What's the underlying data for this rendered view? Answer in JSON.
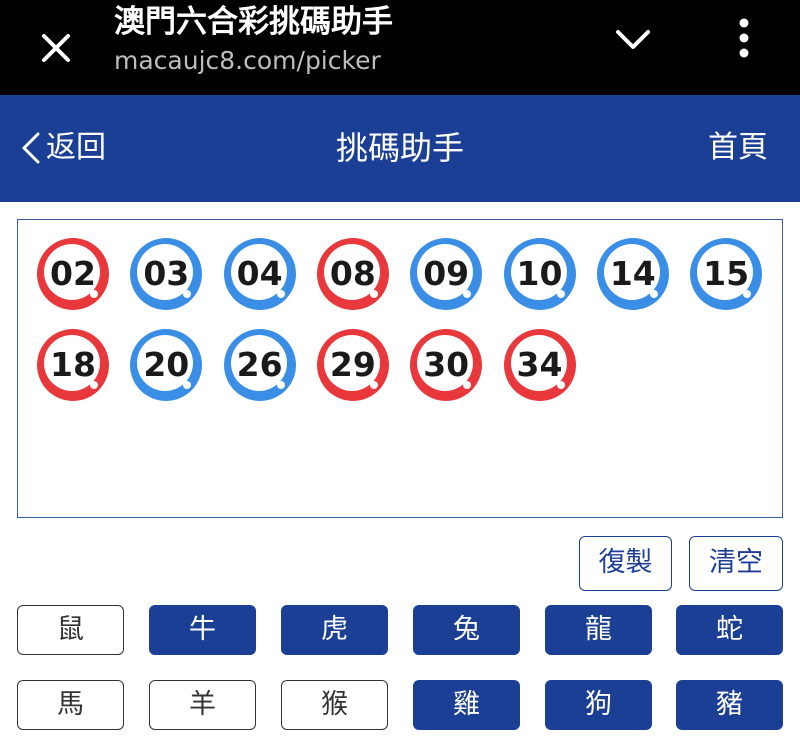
{
  "browser": {
    "title": "澳門六合彩挑碼助手",
    "url": "macaujc8.com/picker",
    "close_icon": "close-icon",
    "expand_icon": "chevron-down-icon",
    "menu_icon": "more-vertical-icon"
  },
  "header": {
    "back_label": "返回",
    "title": "挑碼助手",
    "home_label": "首頁",
    "background": "#1c3f96"
  },
  "colors": {
    "red_ball": "#e8383c",
    "blue_ball": "#3a8ee6",
    "accent": "#1c3f96"
  },
  "selected_numbers": [
    {
      "number": "02",
      "color": "red"
    },
    {
      "number": "03",
      "color": "blue"
    },
    {
      "number": "04",
      "color": "blue"
    },
    {
      "number": "08",
      "color": "red"
    },
    {
      "number": "09",
      "color": "blue"
    },
    {
      "number": "10",
      "color": "blue"
    },
    {
      "number": "14",
      "color": "blue"
    },
    {
      "number": "15",
      "color": "blue"
    },
    {
      "number": "18",
      "color": "red"
    },
    {
      "number": "20",
      "color": "blue"
    },
    {
      "number": "26",
      "color": "blue"
    },
    {
      "number": "29",
      "color": "red"
    },
    {
      "number": "30",
      "color": "red"
    },
    {
      "number": "34",
      "color": "red"
    }
  ],
  "actions": {
    "copy_label": "復製",
    "clear_label": "清空"
  },
  "zodiac": [
    {
      "label": "鼠",
      "selected": false
    },
    {
      "label": "牛",
      "selected": true
    },
    {
      "label": "虎",
      "selected": true
    },
    {
      "label": "兔",
      "selected": true
    },
    {
      "label": "龍",
      "selected": true
    },
    {
      "label": "蛇",
      "selected": true
    },
    {
      "label": "馬",
      "selected": false
    },
    {
      "label": "羊",
      "selected": false
    },
    {
      "label": "猴",
      "selected": false
    },
    {
      "label": "雞",
      "selected": true
    },
    {
      "label": "狗",
      "selected": true
    },
    {
      "label": "豬",
      "selected": true
    }
  ]
}
